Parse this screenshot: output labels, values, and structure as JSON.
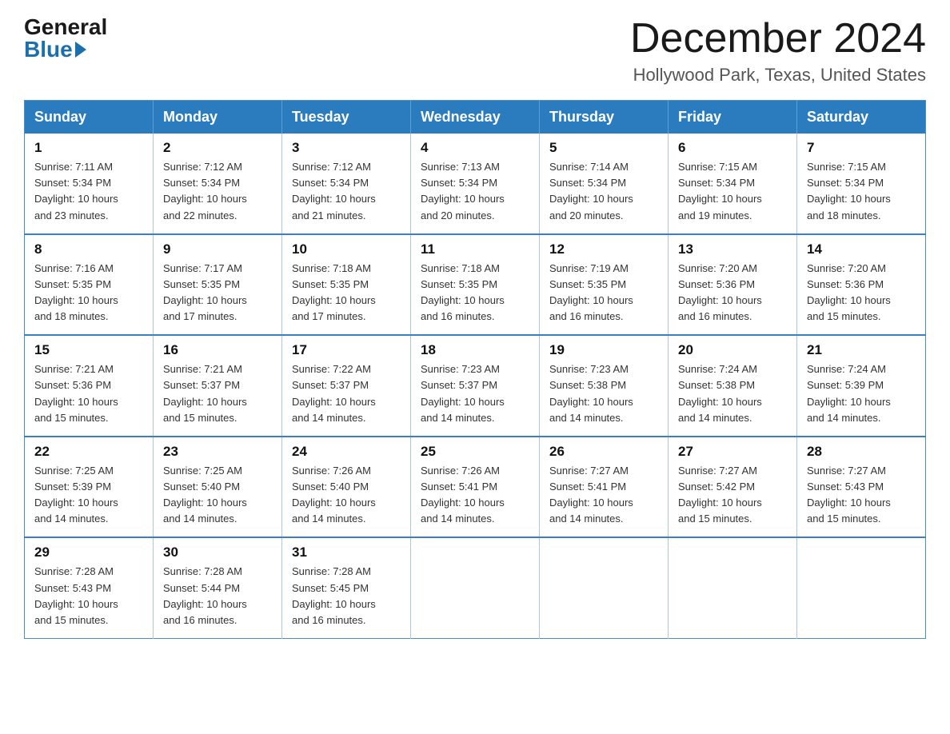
{
  "header": {
    "logo_general": "General",
    "logo_blue": "Blue",
    "month_year": "December 2024",
    "location": "Hollywood Park, Texas, United States"
  },
  "calendar": {
    "days_of_week": [
      "Sunday",
      "Monday",
      "Tuesday",
      "Wednesday",
      "Thursday",
      "Friday",
      "Saturday"
    ],
    "weeks": [
      [
        {
          "day": "1",
          "sunrise": "7:11 AM",
          "sunset": "5:34 PM",
          "daylight": "10 hours and 23 minutes."
        },
        {
          "day": "2",
          "sunrise": "7:12 AM",
          "sunset": "5:34 PM",
          "daylight": "10 hours and 22 minutes."
        },
        {
          "day": "3",
          "sunrise": "7:12 AM",
          "sunset": "5:34 PM",
          "daylight": "10 hours and 21 minutes."
        },
        {
          "day": "4",
          "sunrise": "7:13 AM",
          "sunset": "5:34 PM",
          "daylight": "10 hours and 20 minutes."
        },
        {
          "day": "5",
          "sunrise": "7:14 AM",
          "sunset": "5:34 PM",
          "daylight": "10 hours and 20 minutes."
        },
        {
          "day": "6",
          "sunrise": "7:15 AM",
          "sunset": "5:34 PM",
          "daylight": "10 hours and 19 minutes."
        },
        {
          "day": "7",
          "sunrise": "7:15 AM",
          "sunset": "5:34 PM",
          "daylight": "10 hours and 18 minutes."
        }
      ],
      [
        {
          "day": "8",
          "sunrise": "7:16 AM",
          "sunset": "5:35 PM",
          "daylight": "10 hours and 18 minutes."
        },
        {
          "day": "9",
          "sunrise": "7:17 AM",
          "sunset": "5:35 PM",
          "daylight": "10 hours and 17 minutes."
        },
        {
          "day": "10",
          "sunrise": "7:18 AM",
          "sunset": "5:35 PM",
          "daylight": "10 hours and 17 minutes."
        },
        {
          "day": "11",
          "sunrise": "7:18 AM",
          "sunset": "5:35 PM",
          "daylight": "10 hours and 16 minutes."
        },
        {
          "day": "12",
          "sunrise": "7:19 AM",
          "sunset": "5:35 PM",
          "daylight": "10 hours and 16 minutes."
        },
        {
          "day": "13",
          "sunrise": "7:20 AM",
          "sunset": "5:36 PM",
          "daylight": "10 hours and 16 minutes."
        },
        {
          "day": "14",
          "sunrise": "7:20 AM",
          "sunset": "5:36 PM",
          "daylight": "10 hours and 15 minutes."
        }
      ],
      [
        {
          "day": "15",
          "sunrise": "7:21 AM",
          "sunset": "5:36 PM",
          "daylight": "10 hours and 15 minutes."
        },
        {
          "day": "16",
          "sunrise": "7:21 AM",
          "sunset": "5:37 PM",
          "daylight": "10 hours and 15 minutes."
        },
        {
          "day": "17",
          "sunrise": "7:22 AM",
          "sunset": "5:37 PM",
          "daylight": "10 hours and 14 minutes."
        },
        {
          "day": "18",
          "sunrise": "7:23 AM",
          "sunset": "5:37 PM",
          "daylight": "10 hours and 14 minutes."
        },
        {
          "day": "19",
          "sunrise": "7:23 AM",
          "sunset": "5:38 PM",
          "daylight": "10 hours and 14 minutes."
        },
        {
          "day": "20",
          "sunrise": "7:24 AM",
          "sunset": "5:38 PM",
          "daylight": "10 hours and 14 minutes."
        },
        {
          "day": "21",
          "sunrise": "7:24 AM",
          "sunset": "5:39 PM",
          "daylight": "10 hours and 14 minutes."
        }
      ],
      [
        {
          "day": "22",
          "sunrise": "7:25 AM",
          "sunset": "5:39 PM",
          "daylight": "10 hours and 14 minutes."
        },
        {
          "day": "23",
          "sunrise": "7:25 AM",
          "sunset": "5:40 PM",
          "daylight": "10 hours and 14 minutes."
        },
        {
          "day": "24",
          "sunrise": "7:26 AM",
          "sunset": "5:40 PM",
          "daylight": "10 hours and 14 minutes."
        },
        {
          "day": "25",
          "sunrise": "7:26 AM",
          "sunset": "5:41 PM",
          "daylight": "10 hours and 14 minutes."
        },
        {
          "day": "26",
          "sunrise": "7:27 AM",
          "sunset": "5:41 PM",
          "daylight": "10 hours and 14 minutes."
        },
        {
          "day": "27",
          "sunrise": "7:27 AM",
          "sunset": "5:42 PM",
          "daylight": "10 hours and 15 minutes."
        },
        {
          "day": "28",
          "sunrise": "7:27 AM",
          "sunset": "5:43 PM",
          "daylight": "10 hours and 15 minutes."
        }
      ],
      [
        {
          "day": "29",
          "sunrise": "7:28 AM",
          "sunset": "5:43 PM",
          "daylight": "10 hours and 15 minutes."
        },
        {
          "day": "30",
          "sunrise": "7:28 AM",
          "sunset": "5:44 PM",
          "daylight": "10 hours and 16 minutes."
        },
        {
          "day": "31",
          "sunrise": "7:28 AM",
          "sunset": "5:45 PM",
          "daylight": "10 hours and 16 minutes."
        },
        null,
        null,
        null,
        null
      ]
    ]
  },
  "labels": {
    "sunrise": "Sunrise:",
    "sunset": "Sunset:",
    "daylight": "Daylight:"
  }
}
